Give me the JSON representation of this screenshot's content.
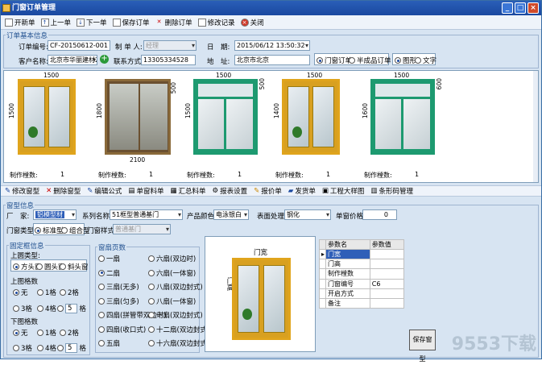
{
  "window": {
    "title": "门窗订单管理"
  },
  "toolbar": [
    "开新单",
    "上一单",
    "下一单",
    "保存订单",
    "删除订单",
    "修改记录",
    "关闭"
  ],
  "basic": {
    "group": "订单基本信息",
    "order_no_label": "订单编号:",
    "order_no": "CF-20150612-001",
    "maker_label": "制 单 人:",
    "maker": "经理",
    "date_label": "日　期:",
    "date": "2015/06/12 13:50:32",
    "customer_label": "客户名称:",
    "customer": "北京市华丽建材2",
    "contact_label": "联系方式:",
    "contact": "13305334528",
    "address_label": "地　址:",
    "address": "北京市北京",
    "order_types": [
      {
        "label": "门窗订单",
        "on": true
      },
      {
        "label": "半成品订单",
        "on": false
      }
    ],
    "display_types": [
      {
        "label": "图形",
        "on": true
      },
      {
        "label": "文字",
        "on": false
      }
    ]
  },
  "gallery": [
    {
      "w": "1500",
      "h": "1500",
      "count_label": "制作樘数:",
      "count": "1"
    },
    {
      "w": "2100",
      "h": "1800",
      "count_label": "制作樘数:",
      "count": "1",
      "side": "500"
    },
    {
      "w": "1500",
      "h": "1500",
      "count_label": "制作樘数:",
      "count": "1",
      "side": "500"
    },
    {
      "w": "1500",
      "h": "1400",
      "count_label": "制作樘数:",
      "count": "1"
    },
    {
      "w": "1500",
      "h": "1600",
      "count_label": "制作樘数:",
      "count": "1",
      "side": "600"
    }
  ],
  "toolbar2": [
    "修改窗型",
    "删除窗型",
    "编辑公式",
    "单窗料单",
    "汇总料单",
    "报表设置",
    "报价单",
    "发货单",
    "工程大样图",
    "条形码管理"
  ],
  "model": {
    "group": "窗型信息",
    "maker_label": "厂　家:",
    "maker": "铝模型材",
    "series_label": "系列名称:",
    "series": "51框型普通基门",
    "color_label": "产品颜色:",
    "color": "电泳银白",
    "surface_label": "表面处理:",
    "surface": "钢化",
    "price_label": "单窗价格:",
    "price": "0",
    "type_label": "门窗类型:",
    "types": [
      {
        "label": "标准型",
        "on": true
      },
      {
        "label": "组合型",
        "on": false
      }
    ],
    "style_label": "门窗样式:",
    "style": "普通基门"
  },
  "fixed": {
    "group": "固定框信息",
    "top_type_label": "上圆类型:",
    "top_types": [
      {
        "label": "方头窗",
        "on": true
      },
      {
        "label": "圆头窗",
        "on": false
      },
      {
        "label": "斜头窗",
        "on": false
      }
    ],
    "top_grid_label": "上图格数",
    "top_grid": [
      {
        "label": "无",
        "on": true
      },
      {
        "label": "1格",
        "on": false
      },
      {
        "label": "2格",
        "on": false
      },
      {
        "label": "3格",
        "on": false
      },
      {
        "label": "4格",
        "on": false
      },
      {
        "label": "5",
        "on": false
      }
    ],
    "bottom_grid_label": "下图格数",
    "bottom_grid": [
      {
        "label": "无",
        "on": true
      },
      {
        "label": "1格",
        "on": false
      },
      {
        "label": "2格",
        "on": false
      },
      {
        "label": "3格",
        "on": false
      },
      {
        "label": "4格",
        "on": false
      },
      {
        "label": "5",
        "on": false
      }
    ],
    "unit": "格"
  },
  "pages": {
    "group": "窗扇页数",
    "left": [
      {
        "label": "一扇",
        "on": false
      },
      {
        "label": "二扇",
        "on": true
      },
      {
        "label": "三扇(无多)",
        "on": false
      },
      {
        "label": "三扇(匀多)",
        "on": false
      },
      {
        "label": "四扇(拼管带双边时)",
        "on": false
      },
      {
        "label": "四扇(收口式)",
        "on": false
      },
      {
        "label": "五扇",
        "on": false
      }
    ],
    "right": [
      {
        "label": "六扇(双边时)",
        "on": false
      },
      {
        "label": "六扇(一体窗)",
        "on": false
      },
      {
        "label": "八扇(双边封式)",
        "on": false
      },
      {
        "label": "八扇(一体窗)",
        "on": false
      },
      {
        "label": "十扇(双边封式)",
        "on": false
      },
      {
        "label": "十二扇(双边封式)",
        "on": false
      },
      {
        "label": "十六扇(双边封式)",
        "on": false
      }
    ]
  },
  "preview": {
    "width_label": "门宽",
    "height_label": "门高"
  },
  "params": {
    "headers": [
      "参数名",
      "参数值"
    ],
    "rows": [
      [
        "门宽",
        ""
      ],
      [
        "门高",
        ""
      ],
      [
        "制作樘数",
        ""
      ],
      [
        "门窗编号",
        "C6"
      ],
      [
        "开启方式",
        ""
      ],
      [
        "备注",
        ""
      ]
    ]
  },
  "save_button": "保存窗型",
  "watermark": "9553下载"
}
